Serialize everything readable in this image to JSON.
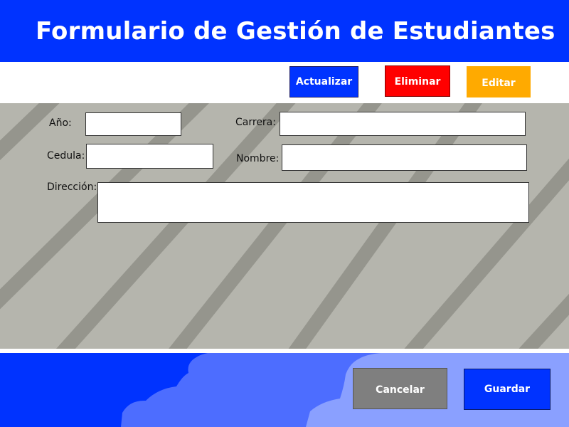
{
  "header": {
    "title": "Formulario de Gestión de Estudiantes"
  },
  "toolbar": {
    "actualizar_label": "Actualizar",
    "eliminar_label": "Eliminar",
    "editar_label": "Editar"
  },
  "form": {
    "anio_label": "Año:",
    "anio_value": "",
    "carrera_label": "Carrera:",
    "carrera_value": "",
    "cedula_label": "Cedula:",
    "cedula_value": "",
    "nombre_label": "Nombre:",
    "nombre_value": "",
    "direccion_label": "Dirección:",
    "direccion_value": ""
  },
  "footer": {
    "cancelar_label": "Cancelar",
    "guardar_label": "Guardar"
  },
  "colors": {
    "primary_blue": "#0033ff",
    "danger_red": "#ff0000",
    "warning_orange": "#ffaa00",
    "neutral_gray": "#7f7f7f",
    "form_background": "#b5b5ad",
    "stripe": "#95958d"
  }
}
